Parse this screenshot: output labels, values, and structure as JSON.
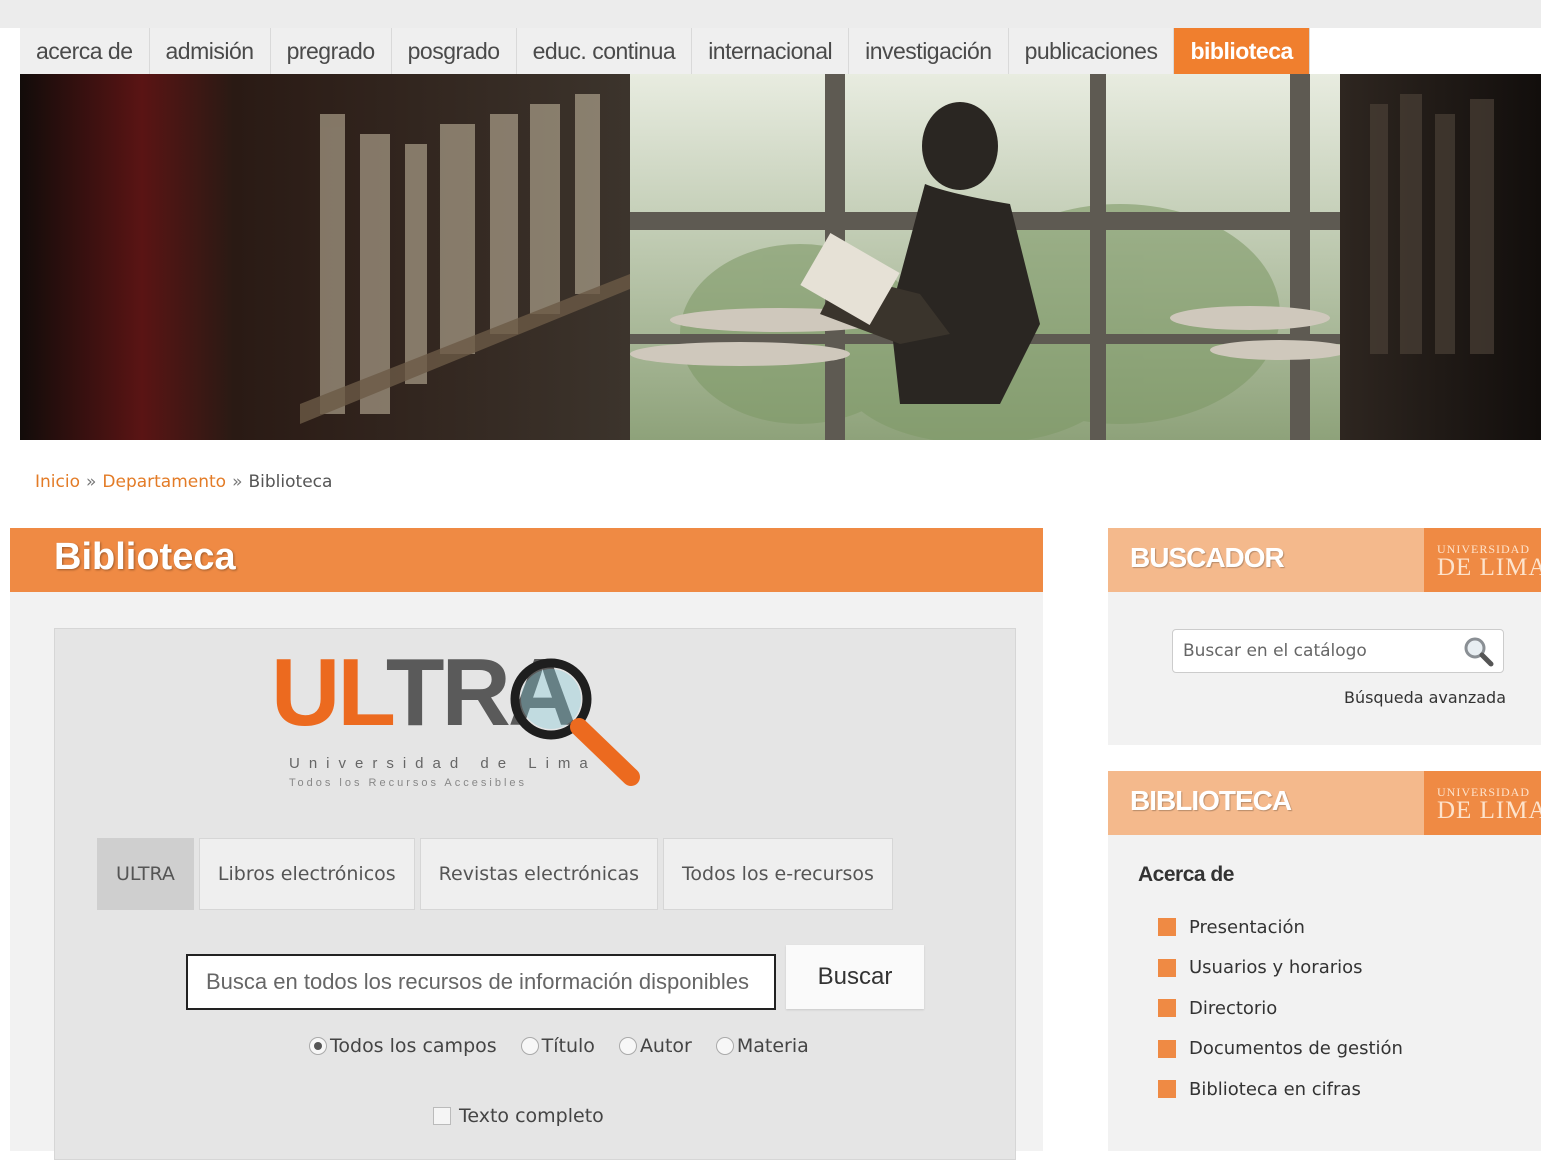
{
  "nav": {
    "items": [
      {
        "label": "acerca de"
      },
      {
        "label": "admisión"
      },
      {
        "label": "pregrado"
      },
      {
        "label": "posgrado"
      },
      {
        "label": "educ. continua"
      },
      {
        "label": "internacional"
      },
      {
        "label": "investigación"
      },
      {
        "label": "publicaciones"
      },
      {
        "label": "biblioteca",
        "active": true
      }
    ]
  },
  "hero": {
    "icon": "library-photo"
  },
  "breadcrumb": {
    "home": "Inicio",
    "separator": "»",
    "department": "Departamento",
    "current": "Biblioteca"
  },
  "main": {
    "title": "Biblioteca",
    "logo": {
      "word_orange": "UL",
      "word_gray": "TR",
      "word_last": "A",
      "subtitle": "Universidad de Lima",
      "tagline": "Todos los Recursos Accesibles"
    },
    "tabs": [
      {
        "label": "ULTRA",
        "active": true
      },
      {
        "label": "Libros electrónicos"
      },
      {
        "label": "Revistas electrónicas"
      },
      {
        "label": "Todos los e-recursos"
      }
    ],
    "search": {
      "placeholder": "Busca en todos los recursos de información disponibles",
      "button_label": "Buscar"
    },
    "fields": [
      {
        "label": "Todos los campos",
        "selected": true
      },
      {
        "label": "Título"
      },
      {
        "label": "Autor"
      },
      {
        "label": "Materia"
      }
    ],
    "fulltext_label": "Texto completo"
  },
  "sidebar": {
    "brand_line1": "UNIVERSIDAD",
    "brand_line2": "DE LIMA",
    "buscador": {
      "title": "BUSCADOR",
      "placeholder": "Buscar en el catálogo",
      "advanced_label": "Búsqueda avanzada"
    },
    "biblioteca": {
      "title": "BIBLIOTECA",
      "subheading": "Acerca de",
      "items": [
        {
          "label": "Presentación"
        },
        {
          "label": "Usuarios y horarios"
        },
        {
          "label": "Directorio"
        },
        {
          "label": "Documentos de gestión"
        },
        {
          "label": "Biblioteca en cifras"
        }
      ]
    }
  },
  "colors": {
    "accent": "#ef8a44",
    "accent_dark": "#ec6a1f",
    "sidebar_header": "#f4b98c",
    "panel_bg": "#f2f2f2"
  }
}
